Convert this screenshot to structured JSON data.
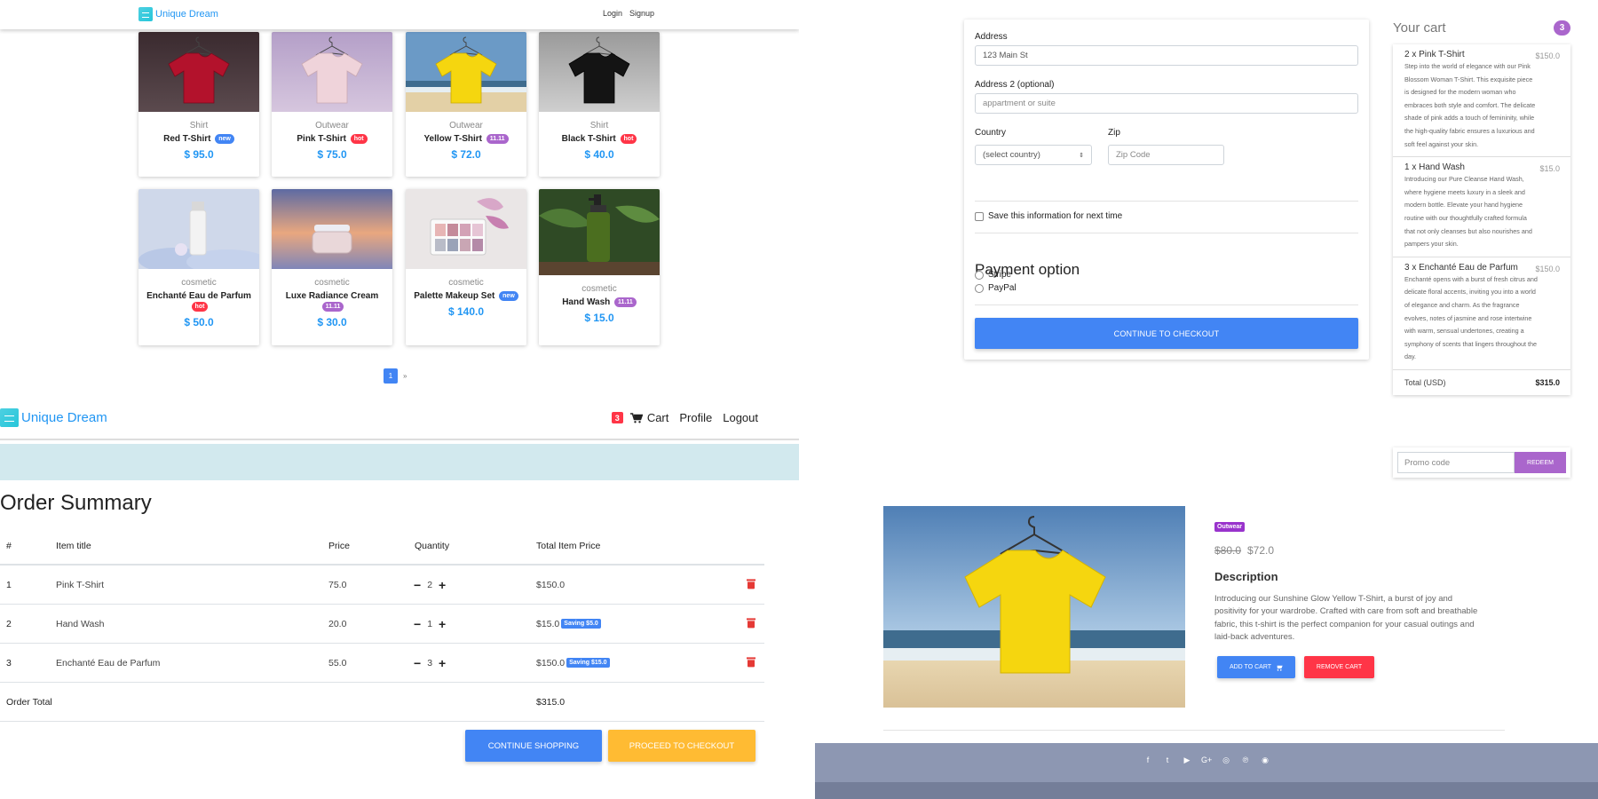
{
  "shop": {
    "brand": "Unique Dream",
    "nav_login": "Login",
    "nav_signup": "Signup",
    "products": [
      {
        "category": "Shirt",
        "title": "Red T-Shirt",
        "badge": "new",
        "badge_type": "new",
        "price": "$ 95.0",
        "img": "red-shirt"
      },
      {
        "category": "Outwear",
        "title": "Pink T-Shirt",
        "badge": "hot",
        "badge_type": "hot",
        "price": "$ 75.0",
        "img": "pink-shirt"
      },
      {
        "category": "Outwear",
        "title": "Yellow T-Shirt",
        "badge": "11.11",
        "badge_type": "sale",
        "price": "$ 72.0",
        "img": "yellow-shirt"
      },
      {
        "category": "Shirt",
        "title": "Black T-Shirt",
        "badge": "hot",
        "badge_type": "hot",
        "price": "$ 40.0",
        "img": "black-shirt"
      },
      {
        "category": "cosmetic",
        "title": "Enchanté Eau de Parfum",
        "badge": "hot",
        "badge_type": "hot",
        "price": "$ 50.0",
        "img": "perfume"
      },
      {
        "category": "cosmetic",
        "title": "Luxe Radiance Cream",
        "badge": "11.11",
        "badge_type": "sale",
        "price": "$ 30.0",
        "img": "cream"
      },
      {
        "category": "cosmetic",
        "title": "Palette Makeup Set",
        "badge": "new",
        "badge_type": "new",
        "price": "$ 140.0",
        "img": "palette"
      },
      {
        "category": "cosmetic",
        "title": "Hand Wash",
        "badge": "11.11",
        "badge_type": "sale",
        "price": "$ 15.0",
        "img": "handwash"
      }
    ],
    "pager_current": "1",
    "pager_next": "»"
  },
  "checkout": {
    "address_label": "Address",
    "address_value": "123 Main St",
    "address2_label": "Address 2 (optional)",
    "address2_placeholder": "appartment or suite",
    "country_label": "Country",
    "country_value": "(select country)",
    "zip_label": "Zip",
    "zip_placeholder": "Zip Code",
    "save_info_label": "Save this information for next time",
    "payment_title": "Payment option",
    "payment_options": [
      "Stripe",
      "PayPal"
    ],
    "continue_button": "CONTINUE TO CHECKOUT",
    "cart_title": "Your cart",
    "cart_count": "3",
    "cart_items": [
      {
        "name": "2 x Pink T-Shirt",
        "price": "$150.0",
        "desc": "Step into the world of elegance with our Pink Blossom Woman T-Shirt. This exquisite piece is designed for the modern woman who embraces both style and comfort. The delicate shade of pink adds a touch of femininity, while the high-quality fabric ensures a luxurious and soft feel against your skin."
      },
      {
        "name": "1 x Hand Wash",
        "price": "$15.0",
        "desc": "Introducing our Pure Cleanse Hand Wash, where hygiene meets luxury in a sleek and modern bottle. Elevate your hand hygiene routine with our thoughtfully crafted formula that not only cleanses but also nourishes and pampers your skin."
      },
      {
        "name": "3 x Enchanté Eau de Parfum",
        "price": "$150.0",
        "desc": "Enchanté opens with a burst of fresh citrus and delicate floral accents, inviting you into a world of elegance and charm. As the fragrance evolves, notes of jasmine and rose intertwine with warm, sensual undertones, creating a symphony of scents that lingers throughout the day."
      }
    ],
    "total_label": "Total (USD)",
    "total_value": "$315.0",
    "promo_placeholder": "Promo code",
    "redeem_button": "REDEEM"
  },
  "order": {
    "brand": "Unique Dream",
    "cart_badge": "3",
    "nav_cart": "Cart",
    "nav_profile": "Profile",
    "nav_logout": "Logout",
    "title": "Order Summary",
    "headers": [
      "#",
      "Item title",
      "Price",
      "Quantity",
      "Total Item Price"
    ],
    "rows": [
      {
        "num": "1",
        "title": "Pink T-Shirt",
        "price": "75.0",
        "qty": "2",
        "total": "$150.0",
        "saving": ""
      },
      {
        "num": "2",
        "title": "Hand Wash",
        "price": "20.0",
        "qty": "1",
        "total": "$15.0",
        "saving": "Saving $5.0"
      },
      {
        "num": "3",
        "title": "Enchanté Eau de Parfum",
        "price": "55.0",
        "qty": "3",
        "total": "$150.0",
        "saving": "Saving $15.0"
      }
    ],
    "order_total_label": "Order Total",
    "order_total_value": "$315.0",
    "continue_shopping": "CONTINUE SHOPPING",
    "proceed_checkout": "PROCEED TO CHECKOUT"
  },
  "product": {
    "category_tag": "Outwear",
    "old_price": "$80.0",
    "new_price": "$72.0",
    "desc_title": "Description",
    "desc": "Introducing our Sunshine Glow Yellow T-Shirt, a burst of joy and positivity for your wardrobe. Crafted with care from soft and breathable fabric, this t-shirt is the perfect companion for your casual outings and laid-back adventures.",
    "add_to_cart": "ADD TO CART",
    "remove_cart": "REMOVE CART",
    "footer_icons": [
      "f",
      "t",
      "▶",
      "G+",
      "◎",
      "℗",
      "◉"
    ]
  },
  "colors": {
    "primary": "#4285f4",
    "brand": "#2196f3",
    "danger": "#ff3547",
    "purple": "#aa66cc",
    "warning": "#ffbb33"
  }
}
